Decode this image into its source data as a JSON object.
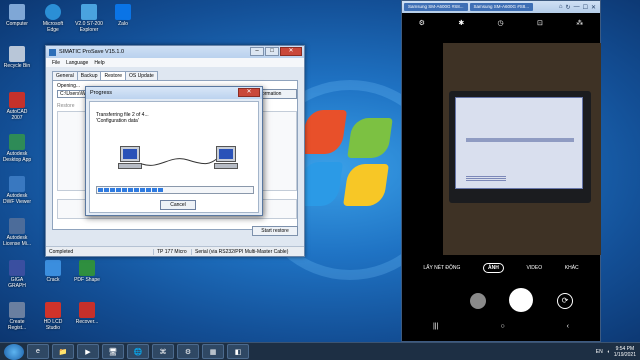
{
  "desktop": {
    "icons": [
      {
        "label": "Computer",
        "color": "#7fa7d6"
      },
      {
        "label": "Microsoft Edge",
        "color": "#2b8fd6"
      },
      {
        "label": "V2.0 S7-200 Explorer",
        "color": "#4aa3df"
      },
      {
        "label": "Zalo",
        "color": "#0a74e6"
      },
      {
        "label": "Recycle Bin",
        "color": "#b8c6d8"
      },
      {
        "label": "AutoCAD 2007",
        "color": "#c4312b"
      },
      {
        "label": "Autodesk Desktop App",
        "color": "#2e8b57"
      },
      {
        "label": "Autodesk DWF Viewer",
        "color": "#3978c0"
      },
      {
        "label": "Autodesk License Mi...",
        "color": "#4c6c9a"
      },
      {
        "label": "GIGA GRAPH",
        "color": "#3a4fa0"
      },
      {
        "label": "Create Regist...",
        "color": "#6a7fa0"
      },
      {
        "label": "Crack",
        "color": "#3b8ede"
      },
      {
        "label": "PDF Shape",
        "color": "#2f8f3f"
      },
      {
        "label": "HD LCD Studio",
        "color": "#d0332a"
      },
      {
        "label": "Recover...",
        "color": "#c6302b"
      }
    ]
  },
  "prosave": {
    "title": "SIMATIC ProSave V15.1.0",
    "menu": [
      "File",
      "Language",
      "Help"
    ],
    "tabs": [
      "General",
      "Backup",
      "Restore",
      "OS Update"
    ],
    "active_tab": "Restore",
    "opening_label": "Opening...",
    "path_value": "C:\\Users\\W",
    "info_button": "formation",
    "restore_checkbox": "Restore",
    "start_button": "Start restore",
    "status": {
      "left": "Completed",
      "device": "TP 177 Micro",
      "connection": "Serial (via RS232/PPI Multi-Master Cable)"
    }
  },
  "progress": {
    "title": "Progress",
    "line1": "Transferring file 2 of 4...",
    "line2": "'Configuration data'",
    "percent": 42,
    "cancel": "Cancel",
    "close_glyph": "✕"
  },
  "phone": {
    "tabs": [
      "Samsung SM-A600G #S8...",
      "Samsung SM-A600G #S8..."
    ],
    "controls": [
      "⌂",
      "↻",
      "—",
      "☐",
      "✕"
    ],
    "top_icons": [
      "⚙",
      "✱",
      "◷",
      "⊡",
      "⁂"
    ],
    "modes": [
      "LẤY NÉT ĐỘNG",
      "ẢNH",
      "VIDEO",
      "KHÁC"
    ],
    "active_mode": "ẢNH",
    "nav": [
      "|||",
      "○",
      "‹"
    ],
    "switch_glyph": "⟳"
  },
  "taskbar": {
    "apps": [
      "e",
      "📁",
      "▶",
      "🖥",
      "🌐",
      "⌘",
      "⚙",
      "▦",
      "◧"
    ],
    "lang": "EN",
    "time": "9:54 PM",
    "date": "1/19/2021"
  }
}
